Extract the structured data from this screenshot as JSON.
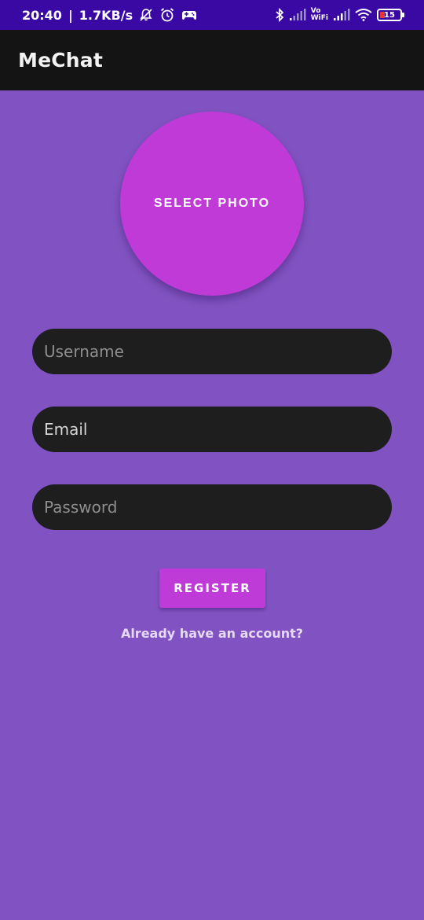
{
  "status_bar": {
    "time": "20:40",
    "network_speed": "1.7KB/s",
    "vowifi_top": "Vo",
    "vowifi_bottom": "WiFi",
    "battery_level": "15",
    "icons": [
      "mute-bell-icon",
      "alarm-icon",
      "game-controller-icon",
      "bluetooth-icon",
      "signal-icon",
      "signal-icon",
      "wifi-icon",
      "battery-icon"
    ]
  },
  "app_bar": {
    "title": "MeChat"
  },
  "form": {
    "select_photo_label": "SELECT PHOTO",
    "username_placeholder": "Username",
    "email_placeholder": "Email",
    "password_placeholder": "Password",
    "register_label": "REGISTER",
    "login_link": "Already have an account?"
  },
  "colors": {
    "background": "#8153c2",
    "status_bar": "#3a09a3",
    "app_bar": "#141414",
    "accent": "#c03ad8",
    "field": "#1e1e1e"
  }
}
